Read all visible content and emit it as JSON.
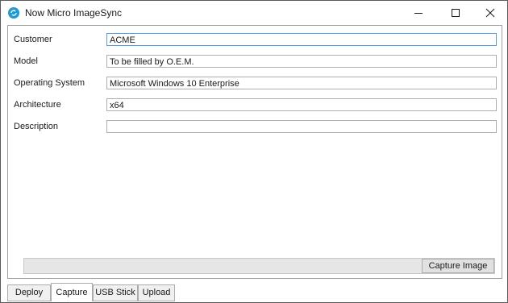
{
  "window": {
    "title": "Now Micro ImageSync",
    "icon": "imagesync-logo-icon",
    "controls": [
      "minimize",
      "maximize",
      "close"
    ]
  },
  "form": {
    "fields": [
      {
        "label": "Customer",
        "value": "ACME"
      },
      {
        "label": "Model",
        "value": "To be filled by O.E.M."
      },
      {
        "label": "Operating System",
        "value": "Microsoft Windows 10 Enterprise"
      },
      {
        "label": "Architecture",
        "value": "x64"
      },
      {
        "label": "Description",
        "value": ""
      }
    ]
  },
  "actions": {
    "capture_label": "Capture Image"
  },
  "tabs": [
    {
      "label": "Deploy",
      "selected": false
    },
    {
      "label": "Capture",
      "selected": true
    },
    {
      "label": "USB Stick",
      "selected": false
    },
    {
      "label": "Upload",
      "selected": false
    }
  ],
  "colors": {
    "accent": "#569de5",
    "icon": "#1e9bd7",
    "border": "#abadb3"
  }
}
